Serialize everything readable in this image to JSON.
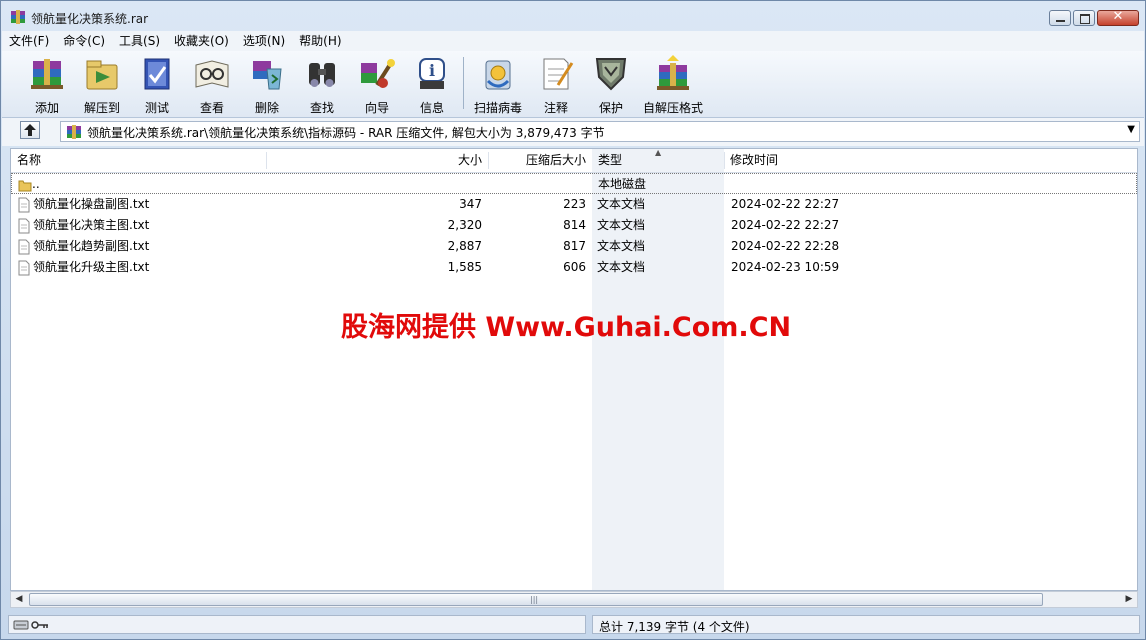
{
  "window": {
    "title": "领航量化决策系统.rar",
    "close_label": "✕"
  },
  "menu": [
    "文件(F)",
    "命令(C)",
    "工具(S)",
    "收藏夹(O)",
    "选项(N)",
    "帮助(H)"
  ],
  "toolbar": [
    {
      "label": "添加",
      "icon": "add-archive-icon"
    },
    {
      "label": "解压到",
      "icon": "extract-to-icon"
    },
    {
      "label": "测试",
      "icon": "test-icon"
    },
    {
      "label": "查看",
      "icon": "view-icon"
    },
    {
      "label": "删除",
      "icon": "delete-icon"
    },
    {
      "label": "查找",
      "icon": "find-icon"
    },
    {
      "label": "向导",
      "icon": "wizard-icon"
    },
    {
      "label": "信息",
      "icon": "info-icon"
    },
    {
      "label": "扫描病毒",
      "icon": "virus-scan-icon"
    },
    {
      "label": "注释",
      "icon": "comment-icon"
    },
    {
      "label": "保护",
      "icon": "protect-icon"
    },
    {
      "label": "自解压格式",
      "icon": "sfx-icon"
    }
  ],
  "address": {
    "path": "领航量化决策系统.rar\\领航量化决策系统\\指标源码 - RAR 压缩文件, 解包大小为 3,879,473 字节"
  },
  "columns": {
    "name": "名称",
    "size": "大小",
    "packed": "压缩后大小",
    "type": "类型",
    "modified": "修改时间"
  },
  "files": [
    {
      "name": "..",
      "size": "",
      "packed": "",
      "type": "本地磁盘",
      "modified": "",
      "kind": "folder"
    },
    {
      "name": "领航量化操盘副图.txt",
      "size": "347",
      "packed": "223",
      "type": "文本文档",
      "modified": "2024-02-22 22:27",
      "kind": "file"
    },
    {
      "name": "领航量化决策主图.txt",
      "size": "2,320",
      "packed": "814",
      "type": "文本文档",
      "modified": "2024-02-22 22:27",
      "kind": "file"
    },
    {
      "name": "领航量化趋势副图.txt",
      "size": "2,887",
      "packed": "817",
      "type": "文本文档",
      "modified": "2024-02-22 22:28",
      "kind": "file"
    },
    {
      "name": "领航量化升级主图.txt",
      "size": "1,585",
      "packed": "606",
      "type": "文本文档",
      "modified": "2024-02-23 10:59",
      "kind": "file"
    }
  ],
  "watermark": "股海网提供 Www.Guhai.Com.CN",
  "status": {
    "summary": "总计 7,139 字节 (4 个文件)"
  },
  "colors": {
    "watermark": "#e10a0a",
    "sort_column_bg": "#eef2f7"
  }
}
